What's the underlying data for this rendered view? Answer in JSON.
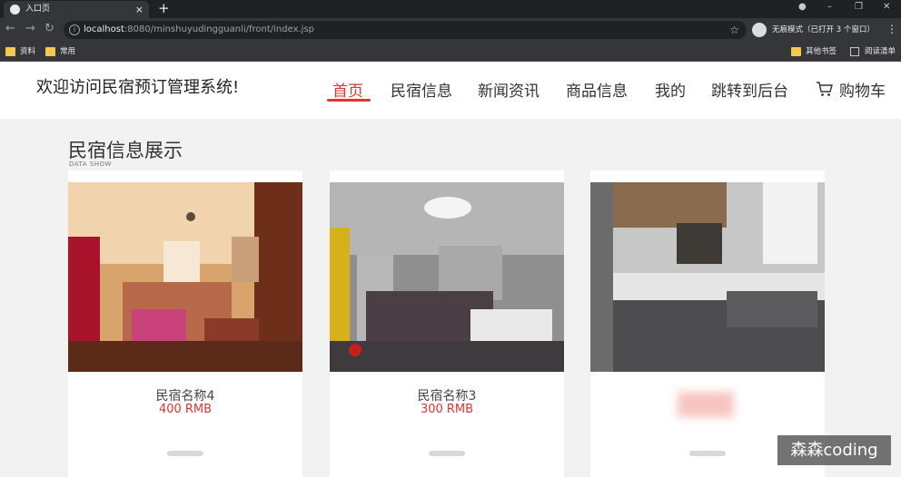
{
  "browser": {
    "tab_title": "入口页",
    "url_host": "localhost",
    "url_rest": ":8080/minshuyudingguanli/front/index.jsp",
    "incognito_label": "无痕模式（已打开 3 个窗口）",
    "bookmarks": [
      "资料",
      "常用"
    ],
    "bookmarks_right": [
      "其他书签",
      "阅读清单"
    ]
  },
  "header": {
    "site_title": "欢迎访问民宿预订管理系统!",
    "nav": [
      "首页",
      "民宿信息",
      "新闻资讯",
      "商品信息",
      "我的",
      "跳转到后台"
    ],
    "cart_label": "购物车",
    "accent_color": "#e0352f"
  },
  "section": {
    "title": "民宿信息展示",
    "subtitle": "DATA SHOW"
  },
  "cards": [
    {
      "name": "民宿名称4",
      "price": "400 RMB"
    },
    {
      "name": "民宿名称3",
      "price": "300 RMB"
    },
    {
      "name": "",
      "price": ""
    }
  ],
  "watermark": "森森coding"
}
